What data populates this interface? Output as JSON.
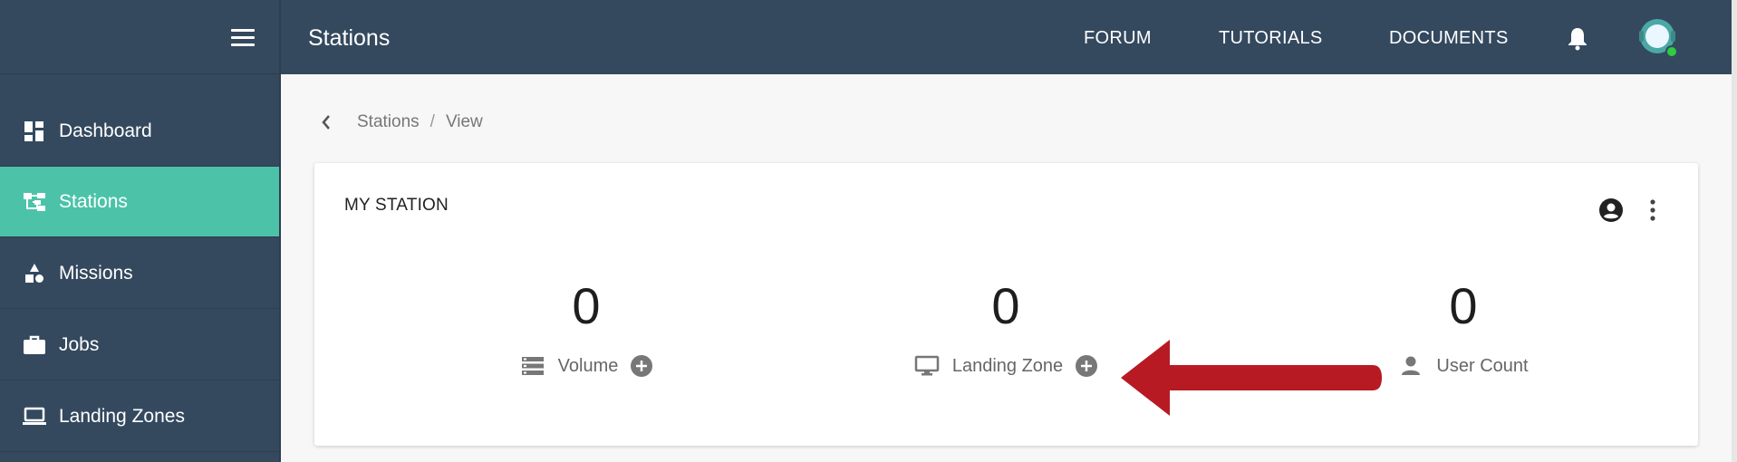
{
  "topbar": {
    "title": "Stations",
    "links": [
      "FORUM",
      "TUTORIALS",
      "DOCUMENTS"
    ]
  },
  "sidebar": {
    "items": [
      {
        "label": "Dashboard",
        "icon": "dashboard-icon"
      },
      {
        "label": "Stations",
        "icon": "stations-icon",
        "active": true
      },
      {
        "label": "Missions",
        "icon": "missions-icon"
      },
      {
        "label": "Jobs",
        "icon": "briefcase-icon"
      },
      {
        "label": "Landing Zones",
        "icon": "laptop-icon"
      }
    ]
  },
  "breadcrumb": {
    "items": [
      "Stations",
      "View"
    ],
    "separator": "/"
  },
  "card": {
    "title": "MY STATION",
    "stats": [
      {
        "value": "0",
        "label": "Volume",
        "icon": "storage-icon",
        "addable": true
      },
      {
        "value": "0",
        "label": "Landing Zone",
        "icon": "monitor-icon",
        "addable": true
      },
      {
        "value": "0",
        "label": "User Count",
        "icon": "person-icon",
        "addable": false
      }
    ]
  },
  "colors": {
    "sidebar_bg": "#34495e",
    "active_item": "#4cc3a9",
    "annotation_arrow": "#b81a24",
    "avatar_status": "#2ecc40"
  }
}
